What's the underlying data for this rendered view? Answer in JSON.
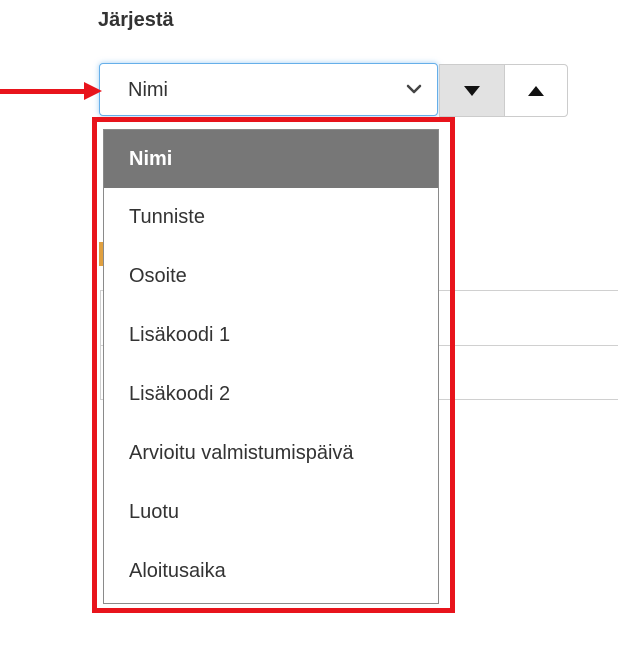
{
  "sort": {
    "label": "Järjestä",
    "selected_value": "Nimi",
    "options": [
      {
        "label": "Nimi",
        "selected": true
      },
      {
        "label": "Tunniste",
        "selected": false
      },
      {
        "label": "Osoite",
        "selected": false
      },
      {
        "label": "Lisäkoodi 1",
        "selected": false
      },
      {
        "label": "Lisäkoodi 2",
        "selected": false
      },
      {
        "label": "Arvioitu valmistumispäivä",
        "selected": false
      },
      {
        "label": "Luotu",
        "selected": false
      },
      {
        "label": "Aloitusaika",
        "selected": false
      }
    ],
    "descending_icon": "caret-down-icon",
    "ascending_icon": "caret-up-icon"
  },
  "annotation": {
    "color": "#e8141c",
    "arrow_icon": "arrow-right-icon"
  },
  "colors": {
    "selected_bg": "#777777",
    "focus_border": "#66afe9",
    "active_button_bg": "#e2e2e2"
  }
}
